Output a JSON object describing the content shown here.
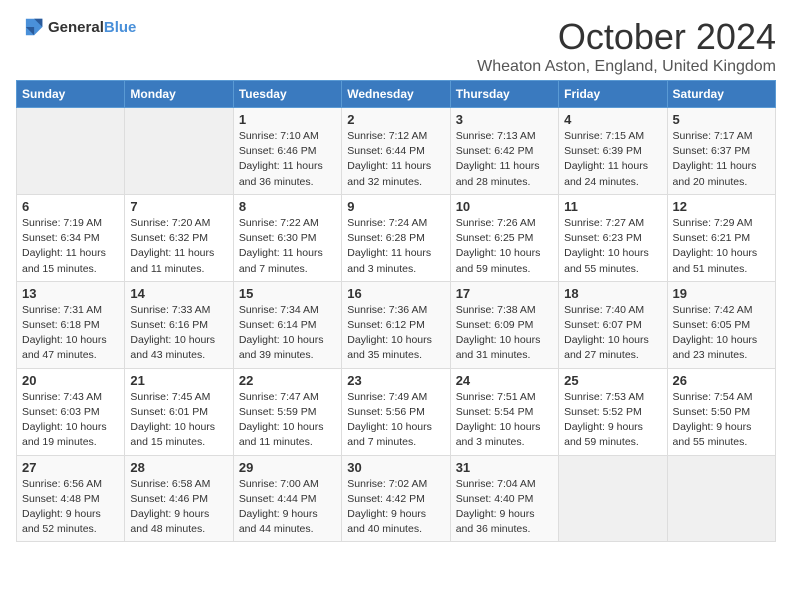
{
  "header": {
    "logo_general": "General",
    "logo_blue": "Blue",
    "month_title": "October 2024",
    "location": "Wheaton Aston, England, United Kingdom"
  },
  "weekdays": [
    "Sunday",
    "Monday",
    "Tuesday",
    "Wednesday",
    "Thursday",
    "Friday",
    "Saturday"
  ],
  "weeks": [
    [
      {
        "day": "",
        "info": ""
      },
      {
        "day": "",
        "info": ""
      },
      {
        "day": "1",
        "info": "Sunrise: 7:10 AM\nSunset: 6:46 PM\nDaylight: 11 hours and 36 minutes."
      },
      {
        "day": "2",
        "info": "Sunrise: 7:12 AM\nSunset: 6:44 PM\nDaylight: 11 hours and 32 minutes."
      },
      {
        "day": "3",
        "info": "Sunrise: 7:13 AM\nSunset: 6:42 PM\nDaylight: 11 hours and 28 minutes."
      },
      {
        "day": "4",
        "info": "Sunrise: 7:15 AM\nSunset: 6:39 PM\nDaylight: 11 hours and 24 minutes."
      },
      {
        "day": "5",
        "info": "Sunrise: 7:17 AM\nSunset: 6:37 PM\nDaylight: 11 hours and 20 minutes."
      }
    ],
    [
      {
        "day": "6",
        "info": "Sunrise: 7:19 AM\nSunset: 6:34 PM\nDaylight: 11 hours and 15 minutes."
      },
      {
        "day": "7",
        "info": "Sunrise: 7:20 AM\nSunset: 6:32 PM\nDaylight: 11 hours and 11 minutes."
      },
      {
        "day": "8",
        "info": "Sunrise: 7:22 AM\nSunset: 6:30 PM\nDaylight: 11 hours and 7 minutes."
      },
      {
        "day": "9",
        "info": "Sunrise: 7:24 AM\nSunset: 6:28 PM\nDaylight: 11 hours and 3 minutes."
      },
      {
        "day": "10",
        "info": "Sunrise: 7:26 AM\nSunset: 6:25 PM\nDaylight: 10 hours and 59 minutes."
      },
      {
        "day": "11",
        "info": "Sunrise: 7:27 AM\nSunset: 6:23 PM\nDaylight: 10 hours and 55 minutes."
      },
      {
        "day": "12",
        "info": "Sunrise: 7:29 AM\nSunset: 6:21 PM\nDaylight: 10 hours and 51 minutes."
      }
    ],
    [
      {
        "day": "13",
        "info": "Sunrise: 7:31 AM\nSunset: 6:18 PM\nDaylight: 10 hours and 47 minutes."
      },
      {
        "day": "14",
        "info": "Sunrise: 7:33 AM\nSunset: 6:16 PM\nDaylight: 10 hours and 43 minutes."
      },
      {
        "day": "15",
        "info": "Sunrise: 7:34 AM\nSunset: 6:14 PM\nDaylight: 10 hours and 39 minutes."
      },
      {
        "day": "16",
        "info": "Sunrise: 7:36 AM\nSunset: 6:12 PM\nDaylight: 10 hours and 35 minutes."
      },
      {
        "day": "17",
        "info": "Sunrise: 7:38 AM\nSunset: 6:09 PM\nDaylight: 10 hours and 31 minutes."
      },
      {
        "day": "18",
        "info": "Sunrise: 7:40 AM\nSunset: 6:07 PM\nDaylight: 10 hours and 27 minutes."
      },
      {
        "day": "19",
        "info": "Sunrise: 7:42 AM\nSunset: 6:05 PM\nDaylight: 10 hours and 23 minutes."
      }
    ],
    [
      {
        "day": "20",
        "info": "Sunrise: 7:43 AM\nSunset: 6:03 PM\nDaylight: 10 hours and 19 minutes."
      },
      {
        "day": "21",
        "info": "Sunrise: 7:45 AM\nSunset: 6:01 PM\nDaylight: 10 hours and 15 minutes."
      },
      {
        "day": "22",
        "info": "Sunrise: 7:47 AM\nSunset: 5:59 PM\nDaylight: 10 hours and 11 minutes."
      },
      {
        "day": "23",
        "info": "Sunrise: 7:49 AM\nSunset: 5:56 PM\nDaylight: 10 hours and 7 minutes."
      },
      {
        "day": "24",
        "info": "Sunrise: 7:51 AM\nSunset: 5:54 PM\nDaylight: 10 hours and 3 minutes."
      },
      {
        "day": "25",
        "info": "Sunrise: 7:53 AM\nSunset: 5:52 PM\nDaylight: 9 hours and 59 minutes."
      },
      {
        "day": "26",
        "info": "Sunrise: 7:54 AM\nSunset: 5:50 PM\nDaylight: 9 hours and 55 minutes."
      }
    ],
    [
      {
        "day": "27",
        "info": "Sunrise: 6:56 AM\nSunset: 4:48 PM\nDaylight: 9 hours and 52 minutes."
      },
      {
        "day": "28",
        "info": "Sunrise: 6:58 AM\nSunset: 4:46 PM\nDaylight: 9 hours and 48 minutes."
      },
      {
        "day": "29",
        "info": "Sunrise: 7:00 AM\nSunset: 4:44 PM\nDaylight: 9 hours and 44 minutes."
      },
      {
        "day": "30",
        "info": "Sunrise: 7:02 AM\nSunset: 4:42 PM\nDaylight: 9 hours and 40 minutes."
      },
      {
        "day": "31",
        "info": "Sunrise: 7:04 AM\nSunset: 4:40 PM\nDaylight: 9 hours and 36 minutes."
      },
      {
        "day": "",
        "info": ""
      },
      {
        "day": "",
        "info": ""
      }
    ]
  ]
}
